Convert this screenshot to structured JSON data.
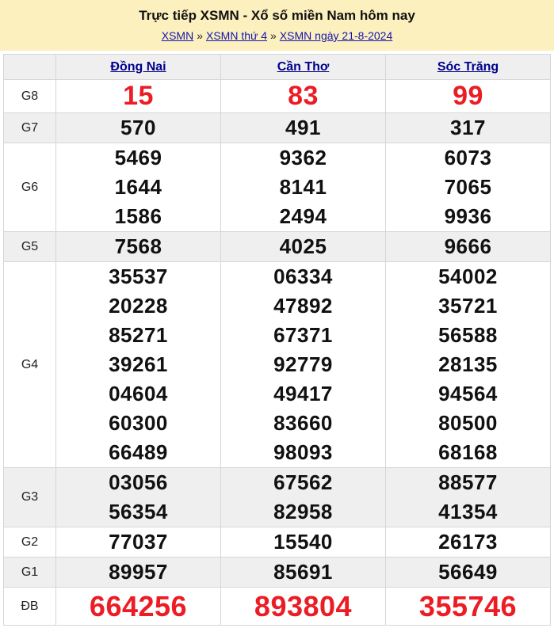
{
  "page": {
    "title": "Trực tiếp XSMN - Xổ số miền Nam hôm nay",
    "breadcrumb_separator": "»",
    "breadcrumb": [
      {
        "label": "XSMN"
      },
      {
        "label": "XSMN thứ 4"
      },
      {
        "label": "XSMN ngày 21-8-2024"
      }
    ]
  },
  "colors": {
    "header_band_bg": "#FCF0BE",
    "highlight_red": "#EC1C24",
    "breadcrumb_link_blue": "#1414AE",
    "column_header_link_navy": "#00008B",
    "alt_row_bg": "#EFEFEF",
    "cell_border": "#D6D6D6"
  },
  "table": {
    "columns": [
      "Đồng Nai",
      "Cần Thơ",
      "Sóc Trăng"
    ],
    "prizes": [
      {
        "label": "G8",
        "style": "hl-large",
        "values": [
          [
            "15"
          ],
          [
            "83"
          ],
          [
            "99"
          ]
        ]
      },
      {
        "label": "G7",
        "style": "",
        "values": [
          [
            "570"
          ],
          [
            "491"
          ],
          [
            "317"
          ]
        ]
      },
      {
        "label": "G6",
        "style": "",
        "values": [
          [
            "5469",
            "1644",
            "1586"
          ],
          [
            "9362",
            "8141",
            "2494"
          ],
          [
            "6073",
            "7065",
            "9936"
          ]
        ]
      },
      {
        "label": "G5",
        "style": "",
        "values": [
          [
            "7568"
          ],
          [
            "4025"
          ],
          [
            "9666"
          ]
        ]
      },
      {
        "label": "G4",
        "style": "",
        "values": [
          [
            "35537",
            "20228",
            "85271",
            "39261",
            "04604",
            "60300",
            "66489"
          ],
          [
            "06334",
            "47892",
            "67371",
            "92779",
            "49417",
            "83660",
            "98093"
          ],
          [
            "54002",
            "35721",
            "56588",
            "28135",
            "94564",
            "80500",
            "68168"
          ]
        ]
      },
      {
        "label": "G3",
        "style": "",
        "values": [
          [
            "03056",
            "56354"
          ],
          [
            "67562",
            "82958"
          ],
          [
            "88577",
            "41354"
          ]
        ]
      },
      {
        "label": "G2",
        "style": "",
        "values": [
          [
            "77037"
          ],
          [
            "15540"
          ],
          [
            "26173"
          ]
        ]
      },
      {
        "label": "G1",
        "style": "",
        "values": [
          [
            "89957"
          ],
          [
            "85691"
          ],
          [
            "56649"
          ]
        ]
      },
      {
        "label": "ĐB",
        "style": "hl-xlarge",
        "values": [
          [
            "664256"
          ],
          [
            "893804"
          ],
          [
            "355746"
          ]
        ]
      }
    ]
  }
}
